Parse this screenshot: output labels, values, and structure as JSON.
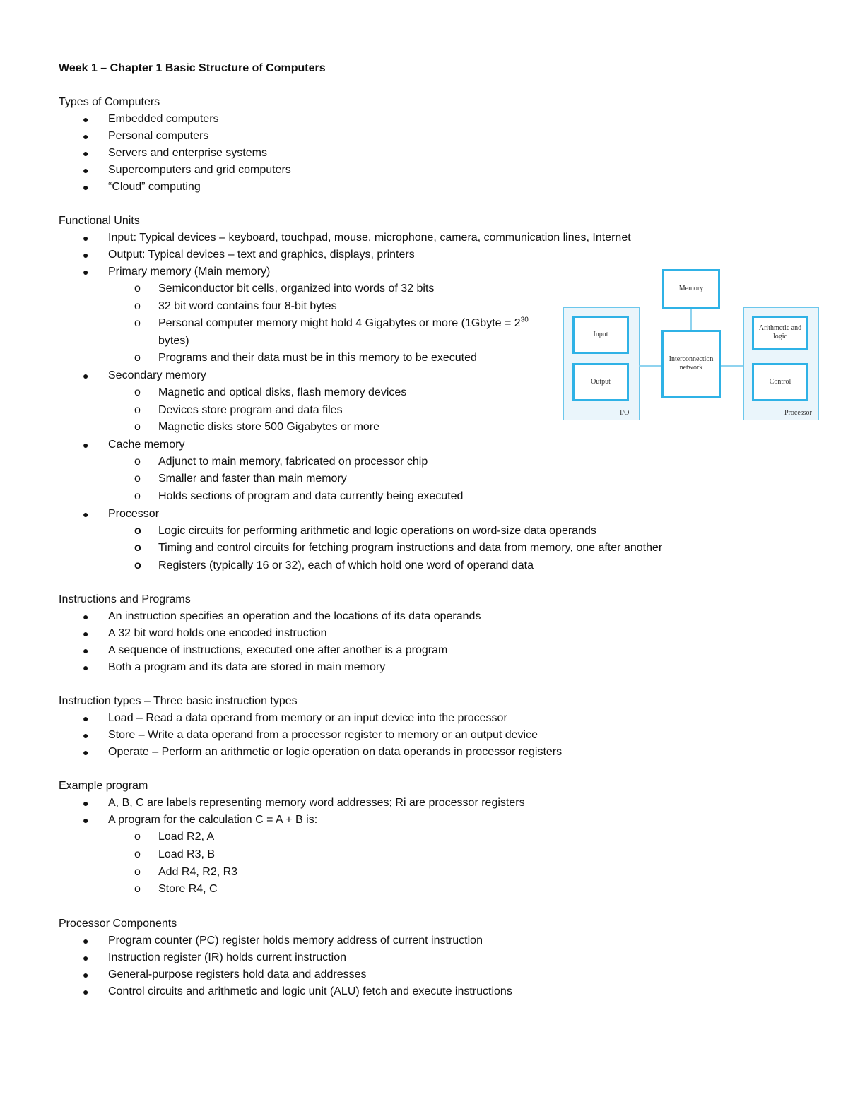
{
  "title": "Week 1 – Chapter 1 Basic Structure of Computers",
  "sections": [
    {
      "heading": "Types of Computers",
      "items": [
        {
          "text": "Embedded computers"
        },
        {
          "text": "Personal computers"
        },
        {
          "text": "Servers and enterprise systems"
        },
        {
          "text": "Supercomputers and grid computers"
        },
        {
          "text": "“Cloud” computing"
        }
      ]
    },
    {
      "heading": "Functional Units",
      "items": [
        {
          "text": "Input: Typical devices – keyboard, touchpad, mouse, microphone, camera, communication lines, Internet"
        },
        {
          "text": "Output: Typical devices – text and graphics, displays, printers"
        },
        {
          "text": "Primary memory (Main memory)",
          "sub": [
            {
              "text": "Semiconductor bit cells, organized into words of 32 bits"
            },
            {
              "text": "32 bit word contains four 8-bit bytes"
            },
            {
              "text": "Personal computer memory might hold 4 Gigabytes or more (1Gbyte = 2",
              "sup": "30",
              "tail": " bytes)"
            },
            {
              "text": "Programs and their data must be in this memory to be executed"
            }
          ]
        },
        {
          "text": "Secondary memory",
          "sub": [
            {
              "text": "Magnetic and optical disks, flash memory devices"
            },
            {
              "text": "Devices store program and data files"
            },
            {
              "text": "Magnetic disks store 500 Gigabytes or more"
            }
          ]
        },
        {
          "text": "Cache memory",
          "sub": [
            {
              "text": "Adjunct to main memory, fabricated on processor chip"
            },
            {
              "text": "Smaller and faster than main memory"
            },
            {
              "text": "Holds sections of program and data currently being executed"
            }
          ]
        },
        {
          "text": "Processor",
          "sub": [
            {
              "text": "Logic circuits for performing arithmetic and logic operations on word-size data operands"
            },
            {
              "text": "Timing and control circuits for fetching program instructions and data from memory, one after another"
            },
            {
              "text": "Registers (typically 16 or 32), each of which hold one word of operand data"
            }
          ]
        }
      ]
    },
    {
      "heading": "Instructions and Programs",
      "items": [
        {
          "text": "An instruction specifies an operation and the locations of its data operands"
        },
        {
          "text": "A 32 bit word holds one encoded instruction"
        },
        {
          "text": "A sequence of instructions, executed one after another is a program"
        },
        {
          "text": "Both a program and its data are stored in main memory"
        }
      ]
    },
    {
      "heading": "Instruction types – Three basic instruction types",
      "items": [
        {
          "text": "Load – Read a data operand from memory or an input device into the processor"
        },
        {
          "text": "Store – Write a data operand from a processor register to memory or an output device"
        },
        {
          "text": "Operate – Perform an arithmetic or logic operation on data operands in processor registers"
        }
      ]
    },
    {
      "heading": "Example program",
      "items": [
        {
          "text": "A, B, C are labels representing memory word addresses; Ri are processor registers"
        },
        {
          "text": "A program for the calculation C = A + B is:",
          "sub": [
            {
              "text": "Load R2, A"
            },
            {
              "text": "Load R3, B"
            },
            {
              "text": "Add R4, R2, R3"
            },
            {
              "text": "Store R4, C"
            }
          ]
        }
      ]
    },
    {
      "heading": "Processor Components",
      "items": [
        {
          "text": "Program counter (PC) register holds memory address of current instruction"
        },
        {
          "text": "Instruction register (IR) holds current instruction"
        },
        {
          "text": "General-purpose registers hold data and addresses"
        },
        {
          "text": "Control circuits and arithmetic and logic unit (ALU) fetch and execute instructions"
        }
      ]
    }
  ],
  "bullets": {
    "level1": "●",
    "level2": "o"
  },
  "diagram": {
    "memory": "Memory",
    "interconnect": "Interconnection network",
    "input": "Input",
    "output": "Output",
    "io_label": "I/O",
    "alu": "Arithmetic and logic",
    "control": "Control",
    "processor_label": "Processor",
    "colors": {
      "border": "#2fb2e6",
      "group_fill": "#eaf5fb"
    }
  }
}
